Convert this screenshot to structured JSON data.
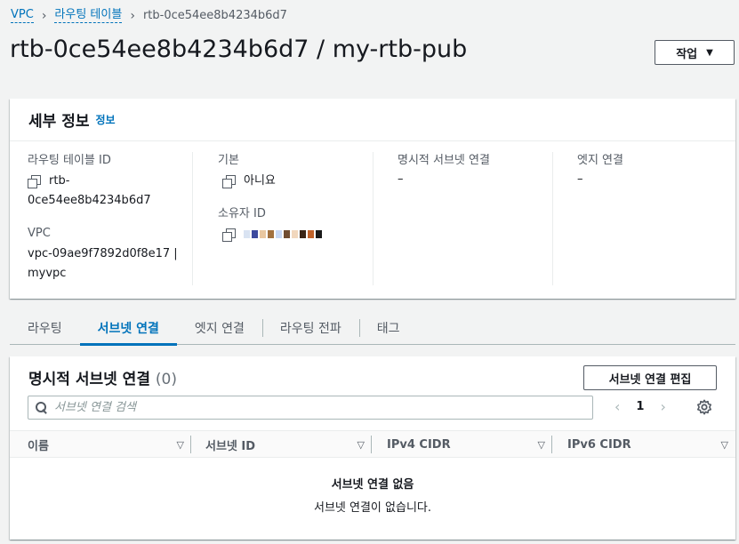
{
  "breadcrumb": {
    "items": [
      "VPC",
      "라우팅 테이블"
    ],
    "current": "rtb-0ce54ee8b4234b6d7"
  },
  "page": {
    "title": "rtb-0ce54ee8b4234b6d7 / my-rtb-pub",
    "actions_label": "작업"
  },
  "details": {
    "heading": "세부 정보",
    "info_label": "정보",
    "route_table_id_label": "라우팅 테이블 ID",
    "route_table_id_value_1": "rtb-",
    "route_table_id_value_2": "0ce54ee8b4234b6d7",
    "vpc_label": "VPC",
    "vpc_value_1": "vpc-09ae9f7892d0f8e17 |",
    "vpc_value_2": "myvpc",
    "main_label": "기본",
    "main_value": "아니요",
    "owner_id_label": "소유자 ID",
    "explicit_subnet_label": "명시적 서브넷 연결",
    "explicit_subnet_value": "–",
    "edge_label": "엣지 연결",
    "edge_value": "–"
  },
  "tabs": [
    "라우팅",
    "서브넷 연결",
    "엣지 연결",
    "라우팅 전파",
    "태그"
  ],
  "active_tab": "서브넷 연결",
  "associations": {
    "title": "명시적 서브넷 연결",
    "count": "(0)",
    "edit_button": "서브넷 연결 편집",
    "search_placeholder": "서브넷 연결 검색",
    "page_number": "1",
    "columns": [
      "이름",
      "서브넷 ID",
      "IPv4 CIDR",
      "IPv6 CIDR"
    ],
    "empty_title": "서브넷 연결 없음",
    "empty_desc": "서브넷 연결이 없습니다."
  },
  "colors": {
    "link": "#0073bb",
    "background": "#f2f3f3",
    "text": "#16191f",
    "muted": "#545b64"
  }
}
